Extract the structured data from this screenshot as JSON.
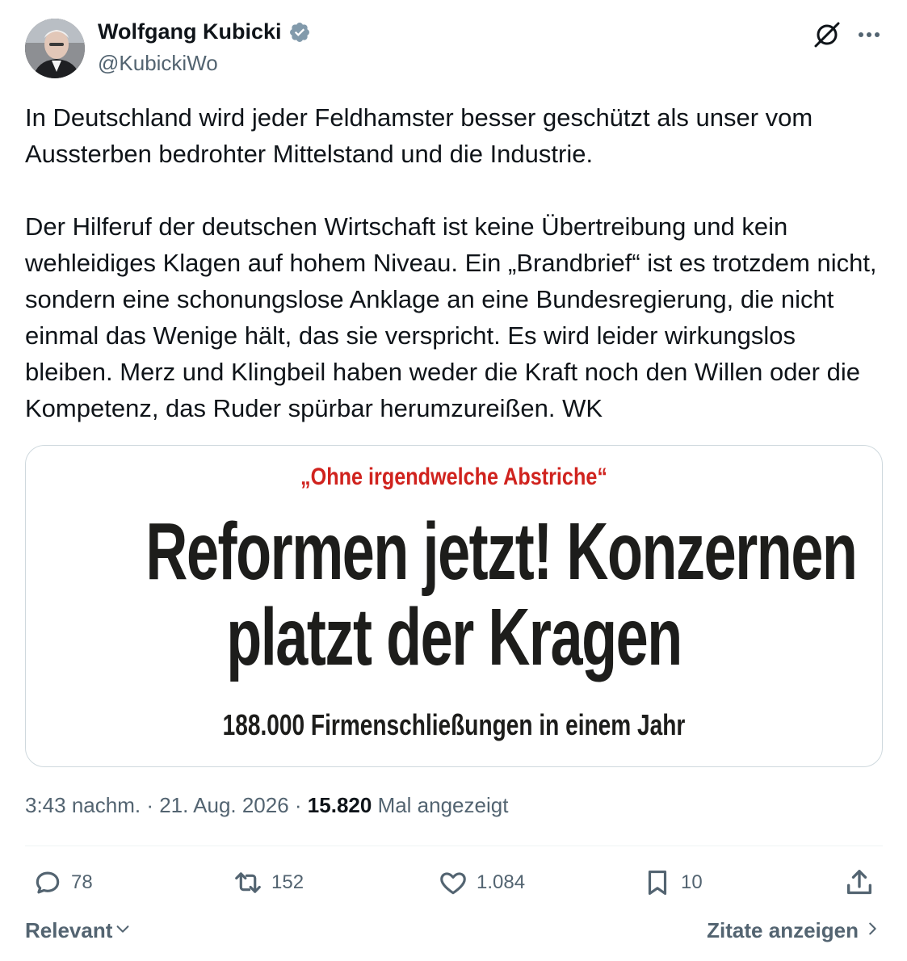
{
  "author": {
    "display_name": "Wolfgang Kubicki",
    "handle": "@KubickiWo"
  },
  "tweet": {
    "paragraphs": [
      "In Deutschland wird jeder Feldhamster besser geschützt als unser vom Aussterben bedrohter Mittelstand und die Industrie.",
      "Der Hilferuf der deutschen Wirtschaft ist keine Übertreibung und kein wehleidiges Klagen auf hohem Niveau. Ein „Brandbrief“ ist es trotzdem nicht, sondern eine schonungslose Anklage an eine Bundesregierung, die nicht einmal das Wenige hält, das sie verspricht. Es wird leider wirkungslos bleiben. Merz und Klingbeil haben weder die Kraft noch den Willen oder die Kompetenz, das Ruder spürbar herumzureißen. WK"
    ]
  },
  "media": {
    "kicker": "„Ohne irgendwelche Abstriche“",
    "headline_line1": "Reformen jetzt! Konzernen",
    "headline_line2": "platzt der Kragen",
    "subline": "188.000 Firmenschließungen in einem Jahr",
    "colors": {
      "kicker": "#d0231e",
      "headline": "#1d1d1b"
    }
  },
  "meta": {
    "time": "3:43 nachm.",
    "separator": " · ",
    "date": "21. Aug. 2026",
    "views_count": "15.820",
    "views_label": "Mal angezeigt"
  },
  "actions": {
    "replies": "78",
    "reposts": "152",
    "likes": "1.084",
    "bookmarks": "10"
  },
  "footer": {
    "sort_label": "Relevant",
    "quotes_label": "Zitate anzeigen"
  },
  "icons": [
    "verified-icon",
    "grok-icon",
    "more-icon",
    "reply-icon",
    "repost-icon",
    "like-icon",
    "bookmark-icon",
    "share-icon",
    "chevron-down-icon",
    "chevron-right-icon"
  ],
  "colors": {
    "text": "#0f1419",
    "secondary": "#536471",
    "verified": "#829aab",
    "border": "#cfd9de"
  }
}
